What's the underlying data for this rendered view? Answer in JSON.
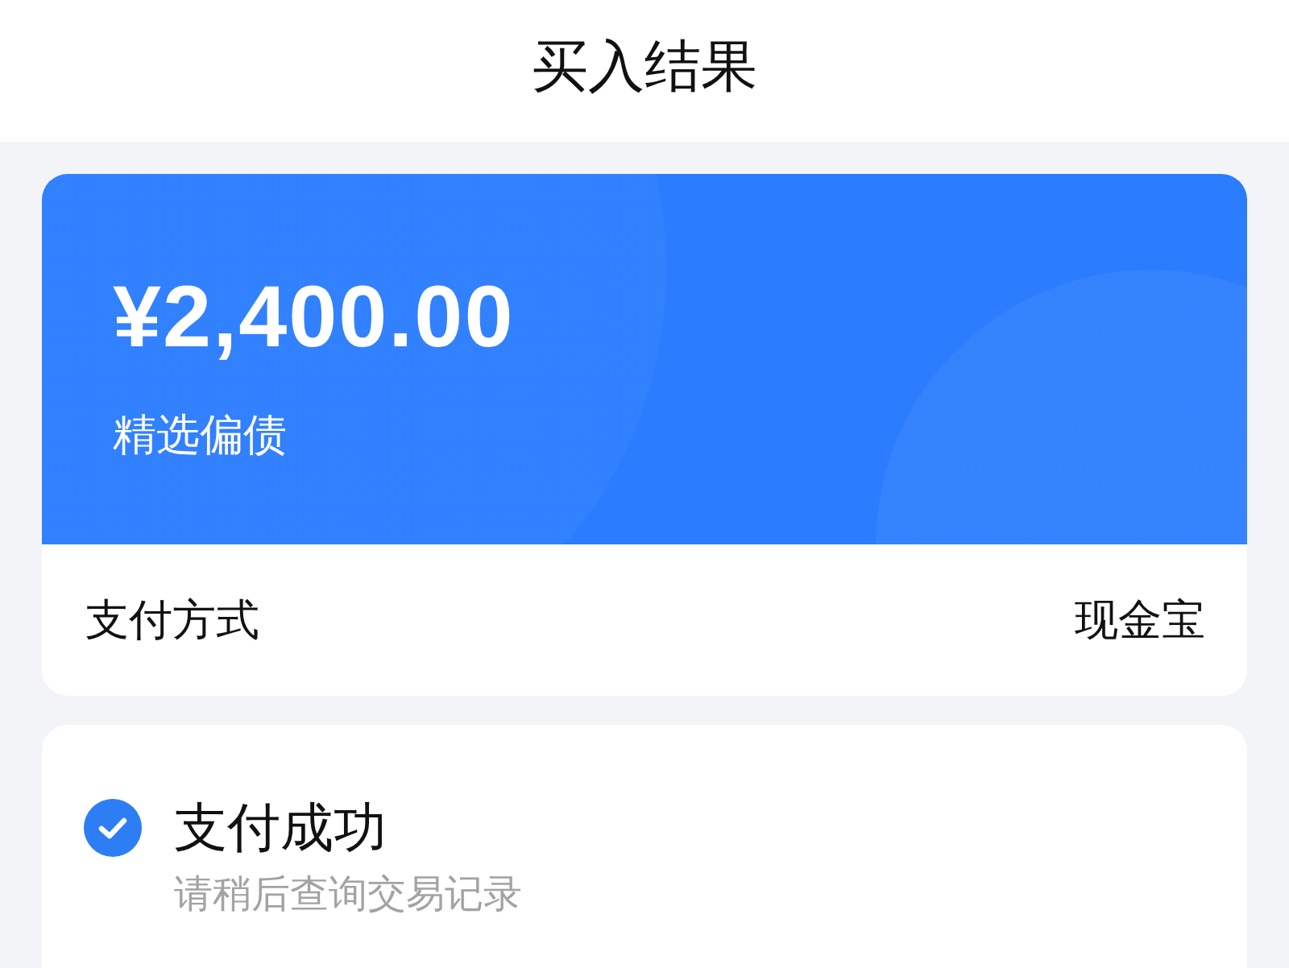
{
  "header": {
    "title": "买入结果"
  },
  "summary": {
    "amount": "¥2,400.00",
    "product": "精选偏债",
    "rows": [
      {
        "label": "支付方式",
        "value": "现金宝"
      }
    ]
  },
  "status": {
    "kind": "success",
    "title": "支付成功",
    "note": "请稍后查询交易记录"
  }
}
